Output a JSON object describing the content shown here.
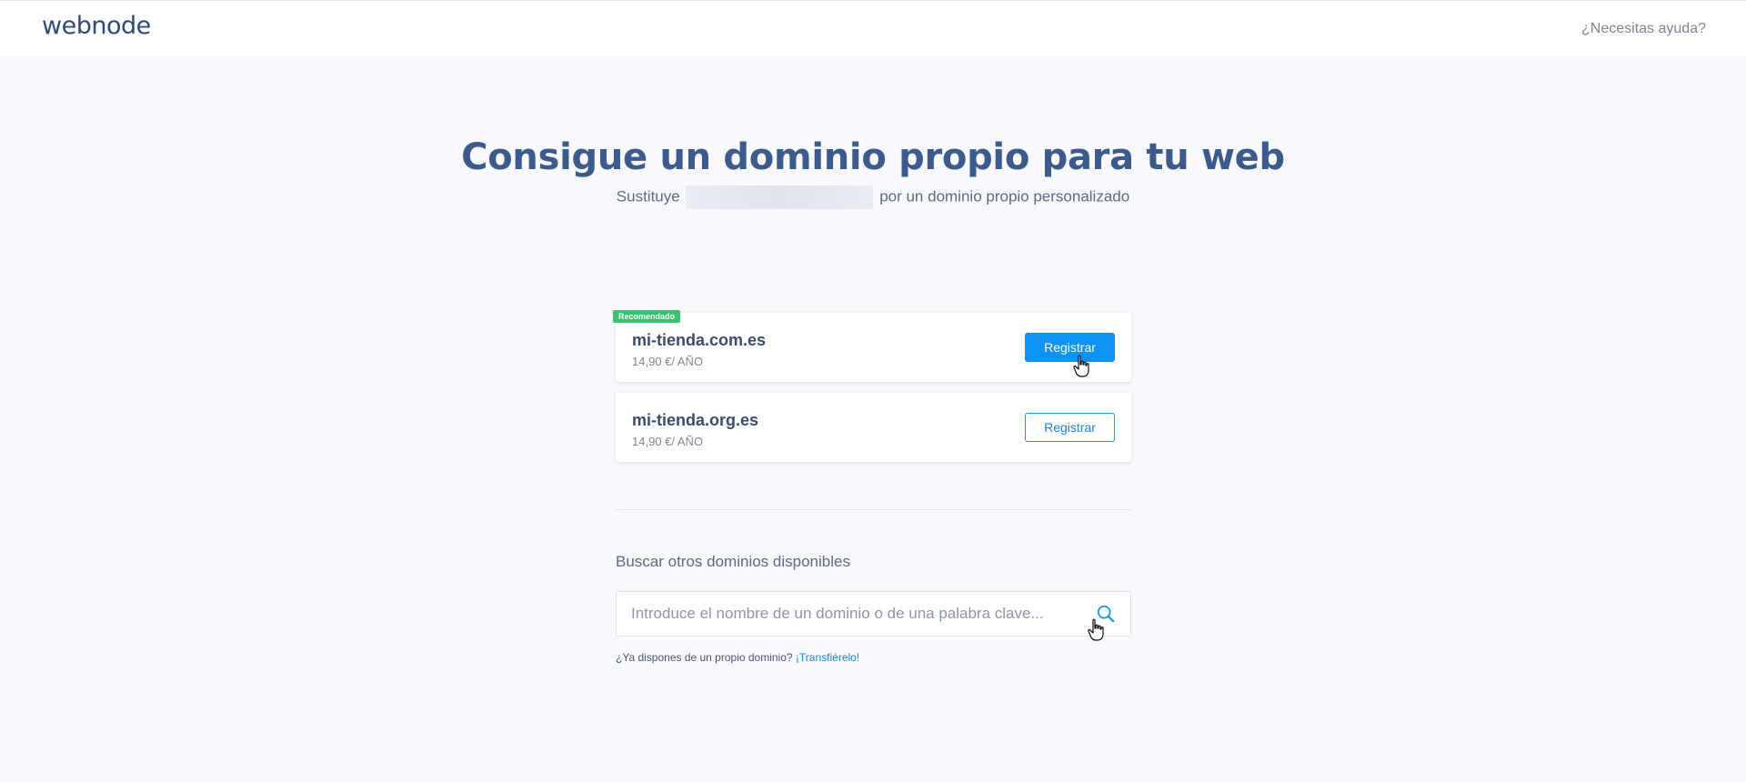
{
  "header": {
    "logo": "webnode",
    "help_link": "¿Necesitas ayuda?"
  },
  "hero": {
    "title": "Consigue un dominio propio para tu web",
    "subtitle_prefix": "Sustituye",
    "subtitle_suffix": "por un dominio propio personalizado"
  },
  "domains": [
    {
      "badge": "Recomendado",
      "name": "mi-tienda.com.es",
      "price": "14,90 €/ AÑO",
      "button_label": "Registrar"
    },
    {
      "name": "mi-tienda.org.es",
      "price": "14,90 €/ AÑO",
      "button_label": "Registrar"
    }
  ],
  "search": {
    "heading": "Buscar otros dominios disponibles",
    "placeholder": "Introduce el nombre de un dominio o de una palabra clave..."
  },
  "transfer": {
    "question": "¿Ya dispones de un propio dominio?",
    "link": "¡Transfiérelo!"
  },
  "colors": {
    "primary": "#0f92f2",
    "badge": "#39c36e",
    "title": "#3d5a8c",
    "background": "#f7f9fc"
  },
  "icons": {
    "search": "search-icon",
    "cursor": "hand-pointer-icon"
  }
}
